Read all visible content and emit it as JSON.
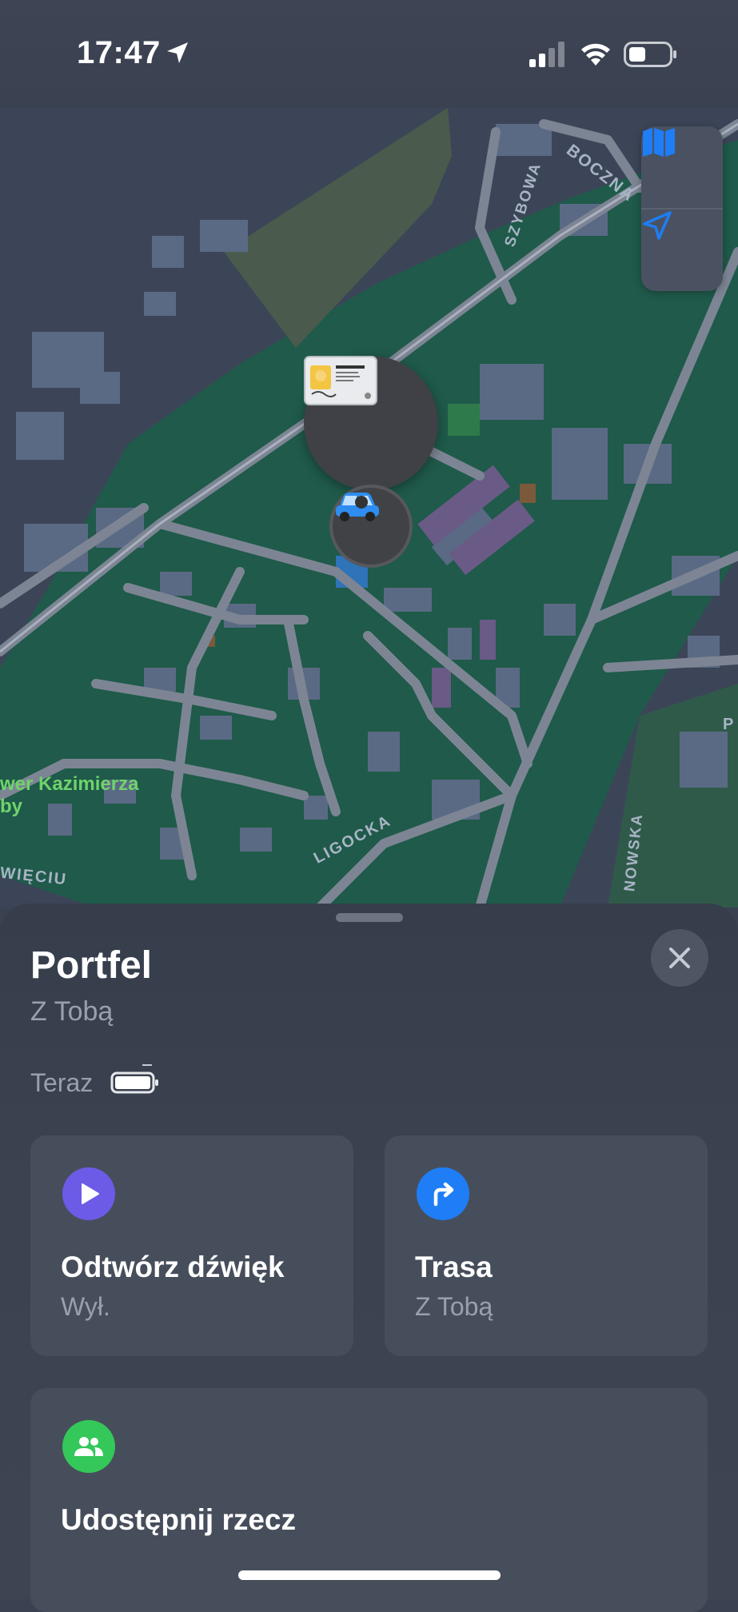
{
  "status_bar": {
    "time": "17:47",
    "icons": [
      "location-arrow-icon",
      "signal-bars-icon",
      "wifi-icon",
      "battery-icon"
    ]
  },
  "map": {
    "street_labels": [
      "BOCZNA",
      "SZYBOWA",
      "LIGOCKA",
      "WIĘCIU",
      "NOWSKA",
      "P"
    ],
    "poi_label_line1": "wer Kazimierza",
    "poi_label_line2": "by",
    "controls": [
      "map-mode-icon",
      "locate-me-icon"
    ],
    "pins": [
      "wallet-card-icon",
      "car-icon"
    ]
  },
  "sheet": {
    "title": "Portfel",
    "subtitle": "Z Tobą",
    "time_label": "Teraz",
    "battery_icon": "battery-low-icon",
    "cards": {
      "play_sound": {
        "title": "Odtwórz dźwięk",
        "subtitle": "Wył.",
        "icon": "play-icon",
        "color": "#6c5be6"
      },
      "route": {
        "title": "Trasa",
        "subtitle": "Z Tobą",
        "icon": "turn-right-arrow-icon",
        "color": "#1f7df5"
      },
      "share": {
        "title": "Udostępnij rzecz",
        "icon": "people-icon",
        "color": "#34c759"
      }
    }
  },
  "colors": {
    "accent_blue": "#2b8bf6",
    "park_green": "#1f5a4a",
    "map_base": "#3c4557"
  }
}
